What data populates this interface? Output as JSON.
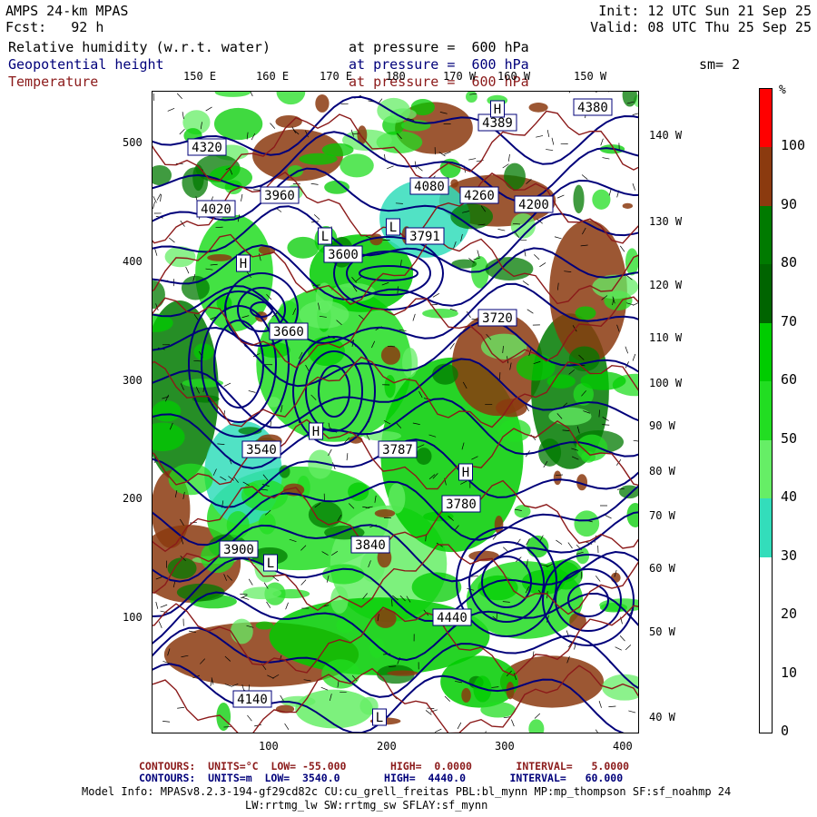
{
  "header": {
    "model": "AMPS 24-km MPAS",
    "forecast": "Fcst:   92 h",
    "init": "Init: 12 UTC Sun 21 Sep 25",
    "valid": "Valid: 08 UTC Thu 25 Sep 25",
    "field1": "Relative humidity (w.r.t. water)",
    "field1_level": "at pressure =  600 hPa",
    "field2": "Geopotential height",
    "field2_level": "at pressure =  600 hPa",
    "field3": "Temperature",
    "field3_level": "at pressure =  600 hPa",
    "smooth": "sm= 2"
  },
  "colors": {
    "rh_title": "#000000",
    "height_title": "#00007a",
    "temp_title": "#8b1a1a",
    "height_contour": "#00007a",
    "temp_contour": "#8b1a1a"
  },
  "map": {
    "top_lon_labels": [
      "150 E",
      "160 E",
      "170 E",
      "180",
      "170 W",
      "160 W",
      "150 W"
    ],
    "right_lon_labels": [
      "140 W",
      "130 W",
      "120 W",
      "110 W",
      "100 W",
      "90 W",
      "80 W",
      "70 W",
      "60 W",
      "50 W",
      "40 W"
    ],
    "x_ticks": [
      "100",
      "200",
      "300",
      "400"
    ],
    "y_ticks": [
      "500",
      "400",
      "300",
      "200",
      "100"
    ],
    "height_labels": [
      "4389",
      "4380",
      "4320",
      "3960",
      "4020",
      "4080",
      "3900",
      "3840",
      "3780",
      "3720",
      "3660",
      "3600",
      "3540",
      "4260",
      "4200",
      "4140",
      "4440",
      "3787",
      "3791",
      "H",
      "H",
      "H",
      "H",
      "L",
      "L",
      "L",
      "L"
    ]
  },
  "colorbar": {
    "unit": "%",
    "labels": [
      "100",
      "90",
      "80",
      "70",
      "60",
      "50",
      "40",
      "30",
      "20",
      "10",
      "0"
    ],
    "segments": [
      {
        "from": 100,
        "to": 110,
        "color": "#ff0000"
      },
      {
        "from": 90,
        "to": 100,
        "color": "#8b3a0f"
      },
      {
        "from": 80,
        "to": 90,
        "color": "#007a00"
      },
      {
        "from": 70,
        "to": 80,
        "color": "#006400"
      },
      {
        "from": 60,
        "to": 70,
        "color": "#00cc00"
      },
      {
        "from": 50,
        "to": 60,
        "color": "#22dd22"
      },
      {
        "from": 40,
        "to": 50,
        "color": "#66ee66"
      },
      {
        "from": 30,
        "to": 40,
        "color": "#33ddbb"
      },
      {
        "from": 20,
        "to": 30,
        "color": "#ffffff"
      },
      {
        "from": 10,
        "to": 20,
        "color": "#ffffff"
      },
      {
        "from": 0,
        "to": 10,
        "color": "#ffffff"
      }
    ]
  },
  "footer": {
    "temp_contours": "CONTOURS:  UNITS=°C  LOW= -55.000       HIGH=  0.0000       INTERVAL=   5.0000",
    "height_contours": "CONTOURS:  UNITS=m  LOW=  3540.0       HIGH=  4440.0       INTERVAL=   60.000",
    "model_info": "Model Info: MPASv8.2.3-194-gf29cd82c CU:cu_grell_freitas PBL:bl_mynn MP:mp_thompson SF:sf_noahmp 24",
    "model_info2": "LW:rrtmg_lw SW:rrtmg_sw SFLAY:sf_mynn"
  }
}
